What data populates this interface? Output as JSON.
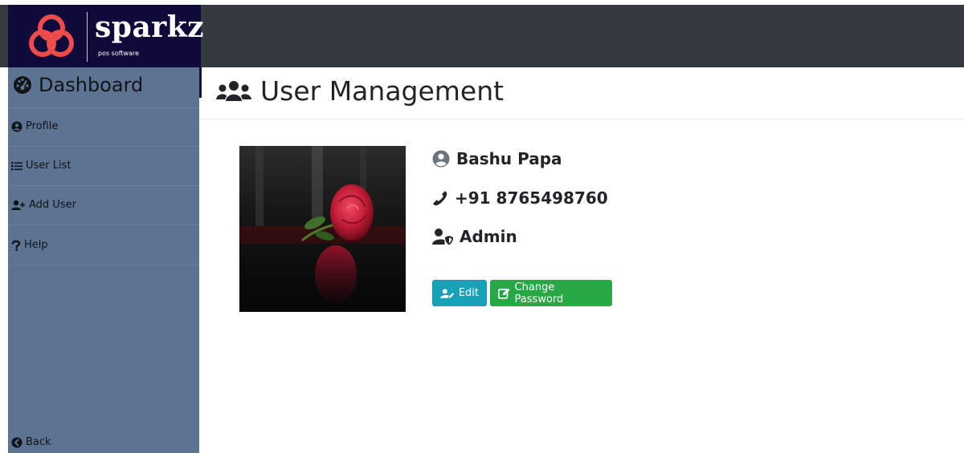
{
  "brand": {
    "name": "sparkz",
    "tagline": "pos software"
  },
  "sidebar": {
    "title": "Dashboard",
    "items": [
      {
        "label": "Profile",
        "icon": "user-circle-icon"
      },
      {
        "label": "User List",
        "icon": "list-icon"
      },
      {
        "label": "Add User",
        "icon": "user-plus-icon"
      },
      {
        "label": "Help",
        "icon": "question-icon"
      }
    ],
    "back_label": "Back"
  },
  "page": {
    "title": "User Management",
    "icon": "users-icon"
  },
  "user": {
    "name": "Bashu Papa",
    "phone": "+91 8765498760",
    "role": "Admin",
    "photo": "rose-photo"
  },
  "actions": {
    "edit_label": "Edit",
    "change_password_label": "Change Password"
  },
  "colors": {
    "topbar": "#343a40",
    "sidebar": "#5d7392",
    "logo_bg": "#0e0a3a",
    "logo_accent": "#ef4b4b",
    "edit": "#17a2b8",
    "change_password": "#28a745"
  }
}
